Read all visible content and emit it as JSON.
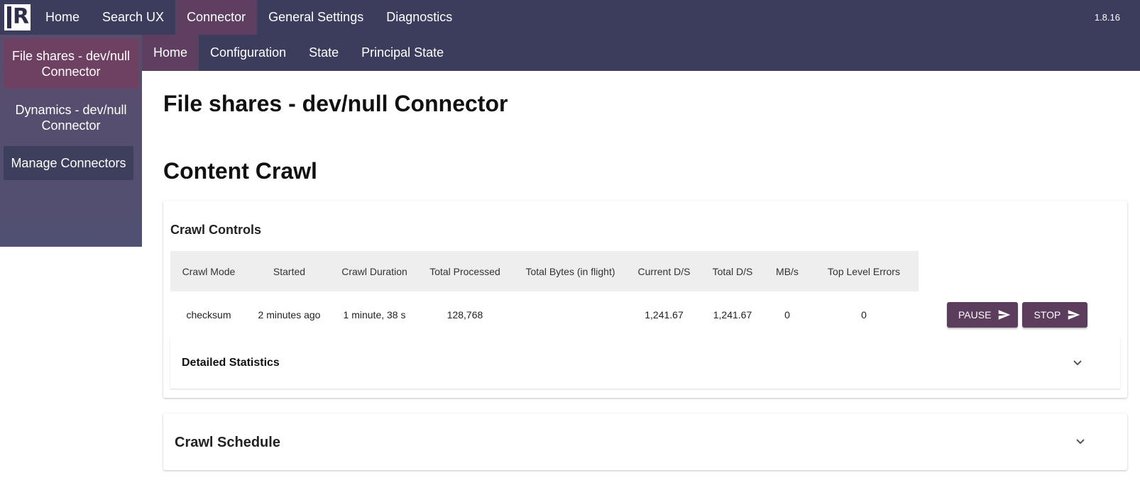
{
  "app": {
    "version": "1.8.16",
    "logo_icon": "ir-logo-icon",
    "accent_color": "#5e3f62",
    "nav_color": "#3c3d5c"
  },
  "topnav": {
    "items": [
      {
        "label": "Home"
      },
      {
        "label": "Search UX"
      },
      {
        "label": "Connector"
      },
      {
        "label": "General Settings"
      },
      {
        "label": "Diagnostics"
      }
    ],
    "active": "Connector"
  },
  "subnav": {
    "items": [
      {
        "label": "Home"
      },
      {
        "label": "Configuration"
      },
      {
        "label": "State"
      },
      {
        "label": "Principal State"
      }
    ],
    "active": "Home"
  },
  "sidebar": {
    "items": [
      {
        "label": "File shares - dev/null Connector"
      },
      {
        "label": "Dynamics - dev/null Connector"
      },
      {
        "label": "Manage Connectors"
      }
    ]
  },
  "main": {
    "title": "File shares - dev/null Connector",
    "section_title": "Content Crawl",
    "crawl_controls": {
      "title": "Crawl Controls",
      "columns": [
        "Crawl Mode",
        "Started",
        "Crawl Duration",
        "Total Processed",
        "Total Bytes (in flight)",
        "Current D/S",
        "Total D/S",
        "MB/s",
        "Top Level Errors"
      ],
      "row": [
        "checksum",
        "2 minutes ago",
        "1 minute, 38 s",
        "128,768",
        "",
        "1,241.67",
        "1,241.67",
        "0",
        "0"
      ],
      "pause_label": "PAUSE",
      "stop_label": "STOP",
      "detailed_statistics_label": "Detailed Statistics"
    },
    "crawl_schedule": {
      "title": "Crawl Schedule"
    }
  }
}
